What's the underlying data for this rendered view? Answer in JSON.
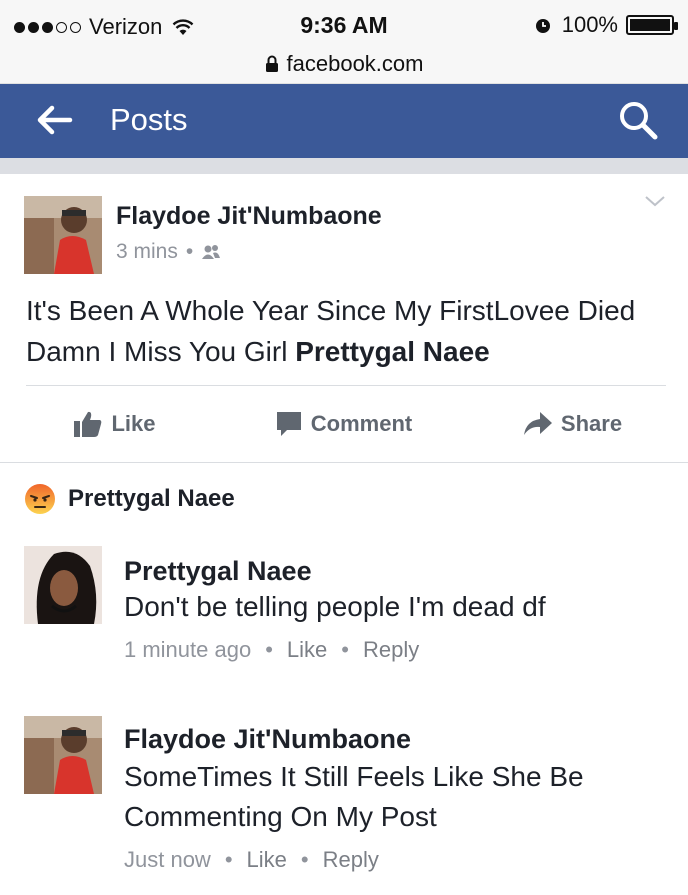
{
  "status_bar": {
    "carrier": "Verizon",
    "time": "9:36 AM",
    "battery": "100%"
  },
  "url_bar": {
    "url": "facebook.com"
  },
  "header": {
    "title": "Posts"
  },
  "post": {
    "author": "Flaydoe Jit'Numbaone",
    "time": "3 mins",
    "privacy_icon": "friends-icon",
    "text": "It's Been A Whole Year Since My FirstLovee Died Damn I Miss You Girl ",
    "mention": "Prettygal Naee",
    "actions": {
      "like": "Like",
      "comment": "Comment",
      "share": "Share"
    }
  },
  "reaction": {
    "type": "angry",
    "name": "Prettygal Naee"
  },
  "comments": [
    {
      "author": "Prettygal Naee",
      "text": "Don't be telling people I'm dead df",
      "time": "1 minute ago",
      "like": "Like",
      "reply": "Reply"
    },
    {
      "author": "Flaydoe Jit'Numbaone",
      "text": "SomeTimes It Still Feels Like She Be Commenting On My Post",
      "time": "Just now",
      "like": "Like",
      "reply": "Reply"
    }
  ],
  "colors": {
    "fb_blue": "#3b5998",
    "meta_gray": "#90949c",
    "angry_orange": "#f0652a"
  }
}
